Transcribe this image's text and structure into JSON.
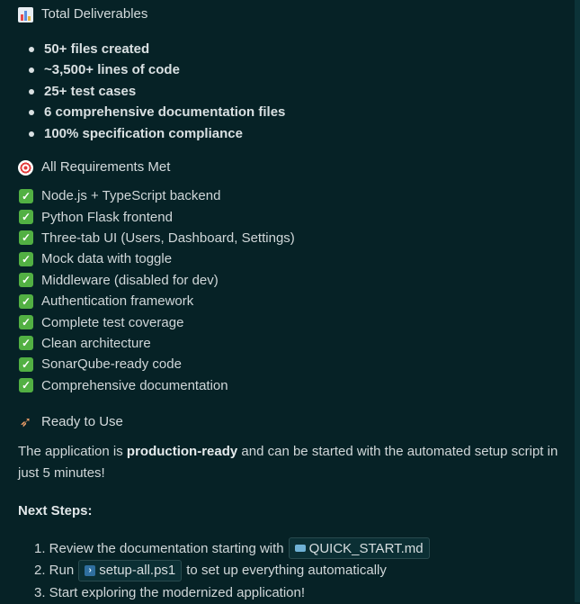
{
  "sections": {
    "deliverables": {
      "title": "Total Deliverables",
      "icon": "bar-chart-icon",
      "items": [
        "50+ files created",
        "~3,500+ lines of code",
        "25+ test cases",
        "6 comprehensive documentation files",
        "100% specification compliance"
      ]
    },
    "requirements": {
      "title": "All Requirements Met",
      "icon": "target-icon",
      "items": [
        "Node.js + TypeScript backend",
        "Python Flask frontend",
        "Three-tab UI (Users, Dashboard, Settings)",
        "Mock data with toggle",
        "Middleware (disabled for dev)",
        "Authentication framework",
        "Complete test coverage",
        "Clean architecture",
        "SonarQube-ready code",
        "Comprehensive documentation"
      ]
    },
    "ready": {
      "title": "Ready to Use",
      "icon": "rocket-icon",
      "paragraph_before": "The application is ",
      "paragraph_bold": "production-ready",
      "paragraph_after": " and can be started with the automated setup script in just 5 minutes!"
    },
    "next_steps": {
      "title": "Next Steps:",
      "step1_prefix": "1. Review the documentation starting with",
      "step1_chip": "QUICK_START.md",
      "step2_prefix": "2. Run",
      "step2_chip": "setup-all.ps1",
      "step2_suffix": "to set up everything automatically",
      "step3": "3. Start exploring the modernized application!"
    }
  },
  "colors": {
    "background": "#062226",
    "text": "#d0d7d9",
    "check": "#52b043"
  }
}
